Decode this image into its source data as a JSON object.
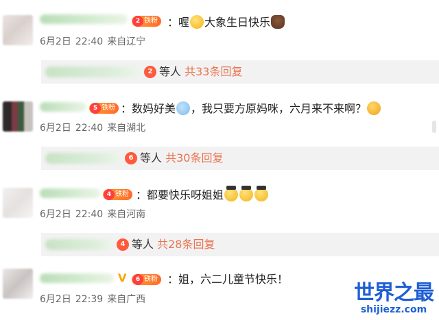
{
  "comments": [
    {
      "badge_level": "2",
      "badge_label": "铁粉",
      "text": "：喔",
      "text_after": "大象生日快乐",
      "date": "6月2日",
      "time": "22:40",
      "location": "来自辽宁",
      "reply": {
        "medal": "2",
        "who": "等人",
        "count": "共33条回复"
      },
      "emojis": [
        "smile-emoji",
        "cake-emoji"
      ]
    },
    {
      "badge_level": "5",
      "badge_label": "铁粉",
      "text": "：数妈好美",
      "text_after": "，我只要方原妈咪，六月来不来啊？",
      "date": "6月2日",
      "time": "22:40",
      "location": "来自湖北",
      "reply": {
        "medal": "6",
        "who": "等人",
        "count": "共30条回复"
      },
      "emojis": [
        "unicorn-emoji",
        "party-emoji"
      ]
    },
    {
      "badge_level": "4",
      "badge_label": "铁粉",
      "text": "：都要快乐呀姐姐",
      "text_after": "",
      "date": "6月2日",
      "time": "22:40",
      "location": "来自河南",
      "reply": {
        "medal": "4",
        "who": "等人",
        "count": "共28条回复"
      },
      "emojis": [
        "graduation-emoji",
        "graduation-emoji",
        "graduation-emoji"
      ]
    },
    {
      "badge_level": "6",
      "badge_label": "铁粉",
      "vip": "V",
      "text": "：姐，六二儿童节快乐！",
      "text_after": "",
      "date": "6月2日",
      "time": "22:39",
      "location": "来自广西"
    }
  ],
  "watermark": {
    "top": "世界之最",
    "bottom": "shijiezz.com"
  },
  "colors": {
    "reply_count": "#eb7350",
    "fan_badge": "#ff7a2a",
    "watermark": "#1f5fd6"
  }
}
